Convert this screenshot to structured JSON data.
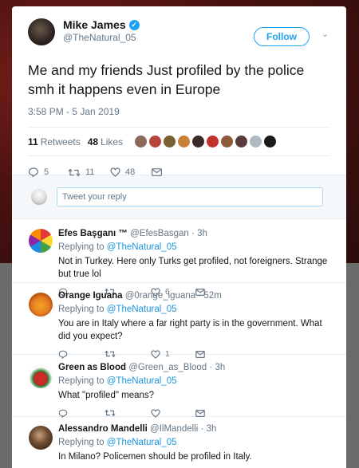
{
  "tweet": {
    "name": "Mike James",
    "handle": "@TheNatural_05",
    "follow_label": "Follow",
    "text": "Me and my friends Just profiled by the police smh it happens even in Europe",
    "timestamp": "3:58 PM - 5 Jan 2019",
    "retweets_count": "11",
    "retweets_label": "Retweets",
    "likes_count": "48",
    "likes_label": "Likes",
    "liker_colors": [
      "#8a6b5a",
      "#b5473a",
      "#7a6030",
      "#c9803a",
      "#3a2a28",
      "#c0322a",
      "#8d5a3a",
      "#5a3a3a",
      "#b0b8c0",
      "#1a1a1a"
    ],
    "actions": {
      "reply_count": "5",
      "retweet_count": "11",
      "like_count": "48"
    }
  },
  "reply_box": {
    "placeholder": "Tweet your reply"
  },
  "replies": [
    {
      "name": "Efes Başganı ™",
      "handle": "@EfesBasgan",
      "time": "3h",
      "replying_prefix": "Replying to",
      "replying_to": "@TheNatural_05",
      "text": "Not in Turkey. Here only Turks get profiled, not foreigners. Strange but true lol",
      "like_count": "6"
    },
    {
      "name": "Orange Iguana",
      "handle": "@0range_iguana",
      "time": "52m",
      "replying_prefix": "Replying to",
      "replying_to": "@TheNatural_05",
      "text": "You are in Italy where a far right party is in the government. What did you expect?",
      "like_count": "1"
    },
    {
      "name": "Green as Blood",
      "handle": "@Green_as_Blood",
      "time": "3h",
      "replying_prefix": "Replying to",
      "replying_to": "@TheNatural_05",
      "text": "What \"profiled\" means?",
      "like_count": ""
    },
    {
      "name": "Alessandro Mandelli",
      "handle": "@IlMandelli",
      "time": "3h",
      "replying_prefix": "Replying to",
      "replying_to": "@TheNatural_05",
      "text": "In Milano? Policemen should be profiled in Italy.",
      "like_count": ""
    }
  ]
}
